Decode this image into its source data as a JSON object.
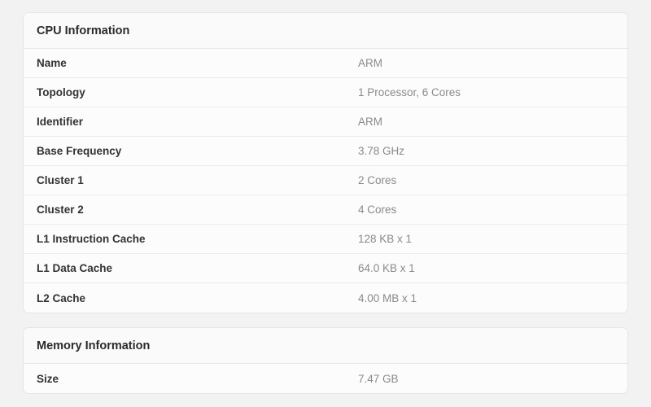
{
  "cpu": {
    "title": "CPU Information",
    "rows": [
      {
        "label": "Name",
        "value": "ARM"
      },
      {
        "label": "Topology",
        "value": "1 Processor, 6 Cores"
      },
      {
        "label": "Identifier",
        "value": "ARM"
      },
      {
        "label": "Base Frequency",
        "value": "3.78 GHz"
      },
      {
        "label": "Cluster 1",
        "value": "2 Cores"
      },
      {
        "label": "Cluster 2",
        "value": "4 Cores"
      },
      {
        "label": "L1 Instruction Cache",
        "value": "128 KB x 1"
      },
      {
        "label": "L1 Data Cache",
        "value": "64.0 KB x 1"
      },
      {
        "label": "L2 Cache",
        "value": "4.00 MB x 1"
      }
    ]
  },
  "memory": {
    "title": "Memory Information",
    "rows": [
      {
        "label": "Size",
        "value": "7.47 GB"
      }
    ]
  }
}
